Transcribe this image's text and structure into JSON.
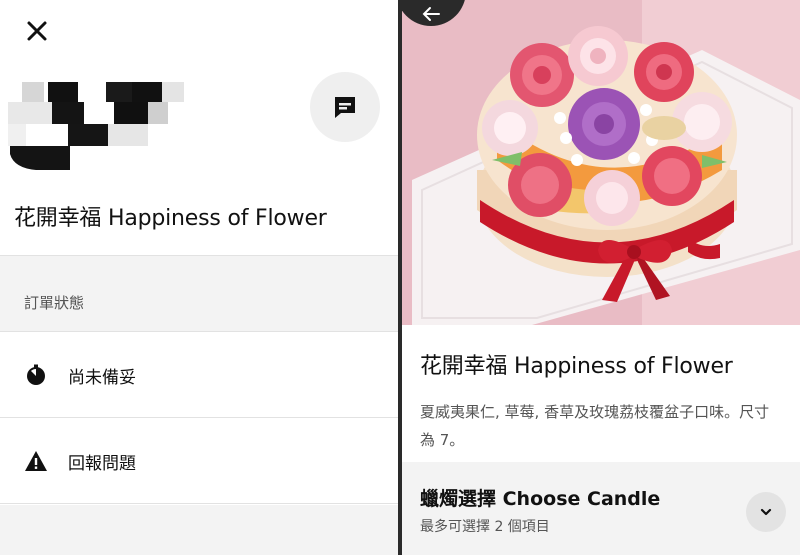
{
  "left_panel": {
    "title": "花開幸福 Happiness of Flower",
    "section_label": "訂單狀態",
    "status_row": {
      "icon": "timer-icon",
      "label": "尚未備妥"
    },
    "report_row": {
      "icon": "warning-icon",
      "label": "回報問題"
    },
    "close_icon": "close-icon",
    "chat_icon": "message-icon"
  },
  "right_panel": {
    "back_icon": "arrow-left-icon",
    "product_title": "花開幸福 Happiness of Flower",
    "product_description": "夏威夷果仁, 草莓, 香草及玫瑰荔枝覆盆子口味。尺寸為 7。",
    "option": {
      "title": "蠟燭選擇 Choose Candle",
      "subtitle": "最多可選擇 2 個項目",
      "chevron_icon": "chevron-down-icon"
    }
  },
  "colors": {
    "background_gray": "#f3f3f3",
    "cake_pink": "#e7b9c2",
    "ribbon_red": "#c8192a"
  }
}
